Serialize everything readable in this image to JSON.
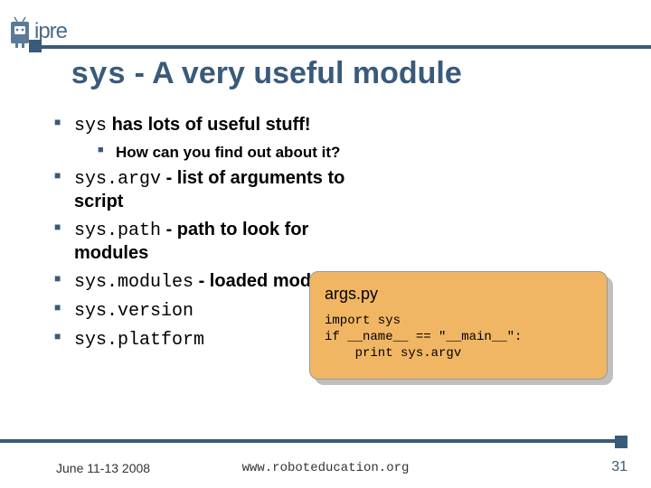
{
  "logo_text": "ipre",
  "title_code": "sys",
  "title_rest": " - A very useful module",
  "bullets": {
    "b1_code": "sys",
    "b1_rest": " has lots of useful stuff!",
    "b1_sub": "How can you find out about it?",
    "b2_code": "sys.argv",
    "b2_rest": " - list of arguments to script",
    "b3_code": "sys.path",
    "b3_rest": " - path to look for modules",
    "b4_code": "sys.modules",
    "b4_rest": " - loaded modules",
    "b5_code": "sys.version",
    "b6_code": "sys.platform"
  },
  "codebox": {
    "title": "args.py",
    "code": "import sys\nif __name__ == \"__main__\":\n    print sys.argv"
  },
  "footer": {
    "date": "June 11-13 2008",
    "url": "www.roboteducation.org",
    "page": "31"
  }
}
